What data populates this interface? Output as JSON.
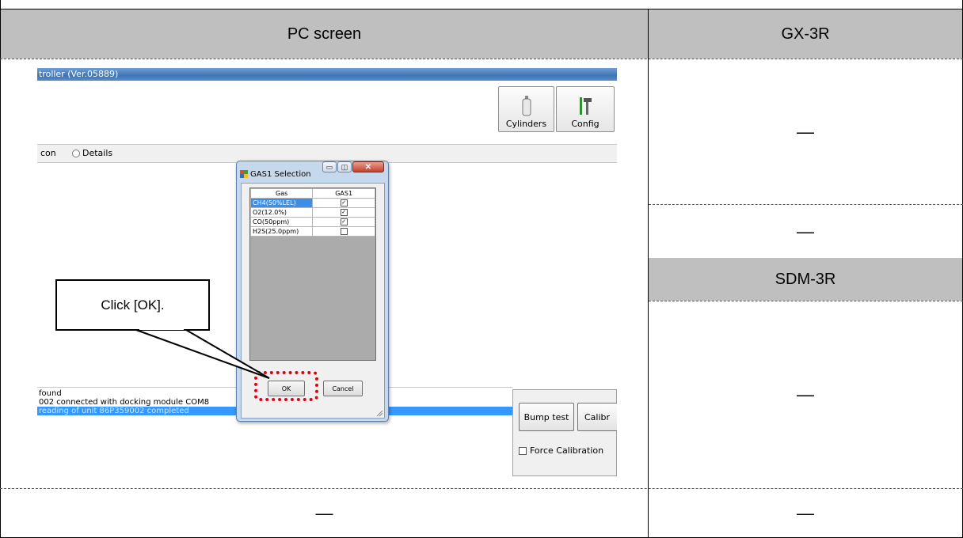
{
  "table": {
    "col_pc": "PC screen",
    "col_gx": "GX-3R",
    "col_sdm": "SDM-3R",
    "dash": "—"
  },
  "screen": {
    "window_title": "troller (Ver.05889)",
    "toolbar": {
      "cylinders": "Cylinders",
      "config": "Config"
    },
    "radio_left": "con",
    "radio_details": "Details",
    "dialog": {
      "title": "GAS1 Selection",
      "col_gas": "Gas",
      "col_gas1": "GAS1",
      "rows": [
        {
          "gas": "CH4(50%LEL)",
          "checked": true
        },
        {
          "gas": "O2(12.0%)",
          "checked": true
        },
        {
          "gas": "CO(50ppm)",
          "checked": true
        },
        {
          "gas": "H2S(25.0ppm)",
          "checked": false
        }
      ],
      "ok": "OK",
      "cancel": "Cancel"
    },
    "log": [
      "found",
      "002 connected with docking module COM8",
      "reading of unit 86P359002 completed"
    ],
    "panel": {
      "bump_test": "Bump test",
      "calibrate": "Calibr",
      "force_calibration": "Force Calibration"
    }
  },
  "callout": {
    "text": "Click [OK]."
  }
}
